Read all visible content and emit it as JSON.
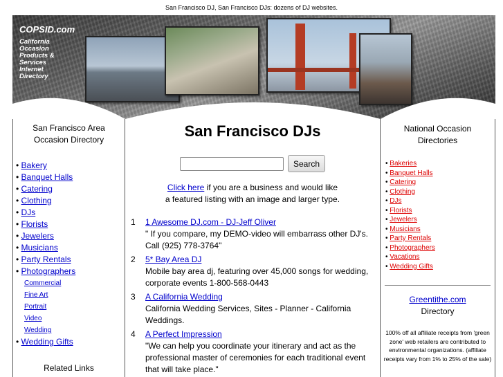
{
  "top_caption": "San Francisco DJ, San Francisco DJs: dozens of DJ websites.",
  "banner": {
    "brand": "COPSID.com",
    "tagline": [
      "California",
      "Occasion",
      "Products &",
      "Services",
      "Internet",
      "Directory"
    ]
  },
  "left": {
    "heading_line1": "San Francisco Area",
    "heading_line2": "Occasion Directory",
    "items": [
      {
        "label": "Bakery"
      },
      {
        "label": "Banquet Halls"
      },
      {
        "label": "Catering"
      },
      {
        "label": "Clothing"
      },
      {
        "label": "DJs"
      },
      {
        "label": "Florists"
      },
      {
        "label": "Jewelers"
      },
      {
        "label": "Musicians"
      },
      {
        "label": "Party Rentals"
      },
      {
        "label": "Photographers"
      }
    ],
    "sub_items": [
      {
        "label": "Commercial"
      },
      {
        "label": "Fine Art"
      },
      {
        "label": "Portrait"
      },
      {
        "label": "Video"
      },
      {
        "label": "Wedding"
      }
    ],
    "last_item": {
      "label": "Wedding Gifts"
    },
    "related_heading": "Related Links"
  },
  "main": {
    "title": "San Francisco DJs",
    "search_button": "Search",
    "search_value": "",
    "featured_link": "Click here",
    "featured_text_1": " if you are a business and would like",
    "featured_text_2": "a featured listing with an image and larger type.",
    "listings": [
      {
        "num": "1",
        "title": "1 Awesome DJ.com - DJ-Jeff Oliver",
        "desc": "\" If you compare, my DEMO-video will embarrass other DJ's. Call (925) 778-3764\""
      },
      {
        "num": "2",
        "title": "5* Bay Area DJ",
        "desc": "Mobile bay area dj, featuring over 45,000 songs for wedding, corporate events 1-800-568-0443"
      },
      {
        "num": "3",
        "title": "A California Wedding",
        "desc": "California Wedding Services, Sites - Planner - California Weddings."
      },
      {
        "num": "4",
        "title": "A Perfect Impression",
        "desc": "\"We can help you coordinate your itinerary and act as the professional master of ceremonies for each traditional event that will take place.\""
      }
    ]
  },
  "right": {
    "heading_line1": "National Occasion",
    "heading_line2": "Directories",
    "items": [
      {
        "label": "Bakeries"
      },
      {
        "label": "Banquet Halls"
      },
      {
        "label": "Catering"
      },
      {
        "label": "Clothing"
      },
      {
        "label": "DJs"
      },
      {
        "label": "Florists"
      },
      {
        "label": "Jewelers"
      },
      {
        "label": "Musicians"
      },
      {
        "label": "Party Rentals"
      },
      {
        "label": "Photographers"
      },
      {
        "label": "Vacations"
      },
      {
        "label": "Wedding Gifts"
      }
    ],
    "greentithe_link": "Greentithe.com",
    "greentithe_sub": "Directory",
    "green_note": "100% off all affiliate receipts from 'green zone' web retailers are contributed to environmental organizations. (affiliate receipts vary from 1% to 25% of the sale)"
  },
  "colors": {
    "link": "#0000cc",
    "national_link": "#dd0000"
  }
}
